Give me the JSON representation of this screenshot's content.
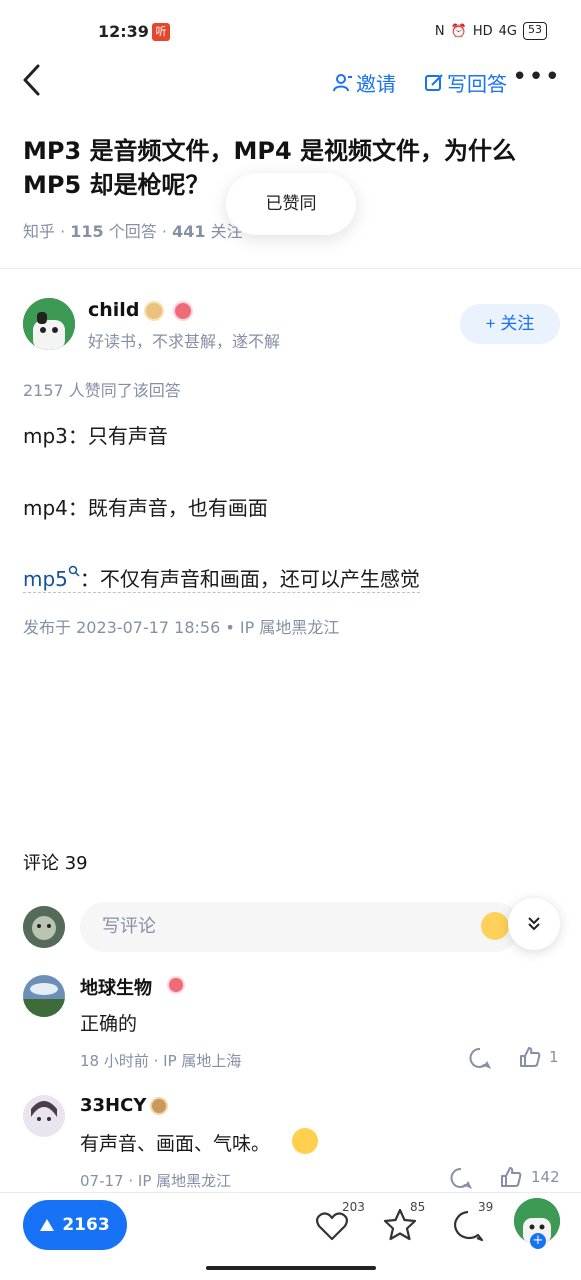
{
  "status": {
    "time": "12:39",
    "app_badge": "听",
    "battery": "53",
    "network": "4G"
  },
  "header": {
    "invite_label": "邀请",
    "write_answer_label": "写回答",
    "more_label": "•••"
  },
  "question": {
    "title": "MP3 是音频文件，MP4 是视频文件，为什么 MP5 却是枪呢？",
    "source": "知乎",
    "answers_count": "115",
    "answers_label": "个回答",
    "followers_count": "441",
    "followers_label": "关注"
  },
  "toast": {
    "text": "已赞同"
  },
  "author": {
    "name": "child",
    "bio": "好读书，不求甚解，遂不解",
    "follow_label": "+ 关注"
  },
  "answer": {
    "votes_text": "2157 人赞同了该回答",
    "lines": [
      "mp3：只有声音",
      "mp4：既有声音，也有画面"
    ],
    "mp5_term": "mp5",
    "mp5_rest": "：不仅有声音和画面，还可以产生感觉",
    "published": "发布于 2023-07-17 18:56 • IP 属地黑龙江"
  },
  "comments": {
    "title": "评论 39",
    "input_placeholder": "写评论",
    "items": [
      {
        "name": "地球生物",
        "text": "正确的",
        "meta": "18 小时前 · IP 属地上海",
        "likes": "1"
      },
      {
        "name": "33HCY",
        "text": "有声音、画面、气味。",
        "meta": "07-17 · IP 属地黑龙江",
        "likes": "142"
      }
    ]
  },
  "bottombar": {
    "vote_count": "2163",
    "like_count": "203",
    "star_count": "85",
    "comment_count": "39"
  },
  "colors": {
    "accent": "#1772f6",
    "meta": "#8590a6"
  }
}
